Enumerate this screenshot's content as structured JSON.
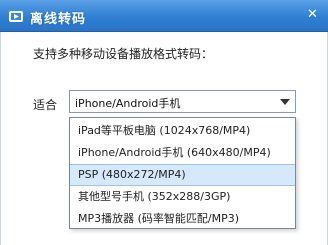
{
  "window": {
    "title": "离线转码",
    "close_glyph": "✕",
    "icon": "app-logo-icon"
  },
  "dialog": {
    "description": "支持多种移动设备播放格式转码：",
    "fit_label": "适合",
    "select": {
      "value": "iPhone/Android手机"
    },
    "options": [
      {
        "label": "iPad等平板电脑 (1024x768/MP4)",
        "selected": false
      },
      {
        "label": "iPhone/Android手机 (640x480/MP4)",
        "selected": false
      },
      {
        "label": "PSP (480x272/MP4)",
        "selected": true
      },
      {
        "label": "其他型号手机 (352x288/3GP)",
        "selected": false
      },
      {
        "label": "MP3播放器 (码率智能匹配/MP3)",
        "selected": false
      }
    ]
  },
  "colors": {
    "titlebar": "#2f7fd3",
    "selection": "#d6e8fb"
  }
}
